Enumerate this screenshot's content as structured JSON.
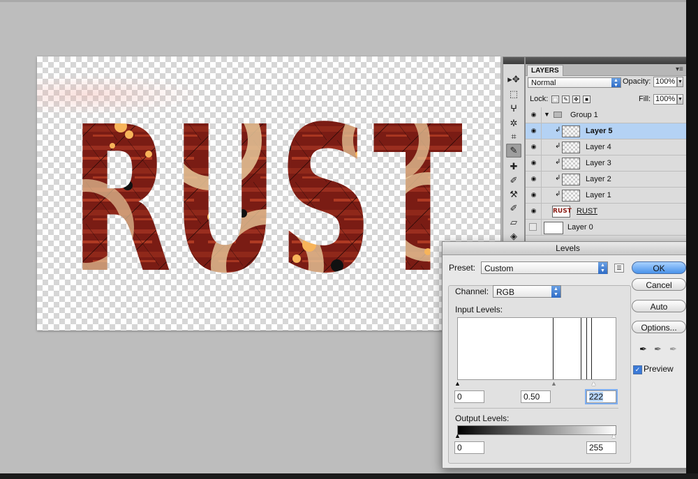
{
  "canvas": {
    "artwork_text": "RUST",
    "colors": {
      "rust_base": "#7a1c14",
      "rust_mid": "#a33222",
      "rust_light": "#c6482a",
      "speckle": "#f7b45a",
      "ring": "#e8c89a",
      "checker": "#d6d6d6"
    }
  },
  "tools": {
    "items": [
      "move-icon",
      "marquee-icon",
      "lasso-icon",
      "magic-wand-icon",
      "crop-icon",
      "eyedropper-icon",
      "healing-brush-icon",
      "brush-icon",
      "clone-stamp-icon",
      "history-brush-icon",
      "eraser-icon",
      "paint-bucket-icon"
    ],
    "glyphs": [
      "▸✥",
      "⬚",
      "ⵖ",
      "✲",
      "⌗",
      "✎",
      "✚",
      "✐",
      "⚒",
      "✐",
      "▱",
      "◈"
    ]
  },
  "layers_panel": {
    "tab_label": "LAYERS",
    "blend_mode": "Normal",
    "opacity_label": "Opacity:",
    "opacity_value": "100%",
    "lock_label": "Lock:",
    "fill_label": "Fill:",
    "fill_value": "100%",
    "layers": [
      {
        "name": "Group 1",
        "type": "group"
      },
      {
        "name": "Layer 5",
        "type": "clipped",
        "selected": true
      },
      {
        "name": "Layer 4",
        "type": "clipped"
      },
      {
        "name": "Layer 3",
        "type": "clipped"
      },
      {
        "name": "Layer 2",
        "type": "clipped"
      },
      {
        "name": "Layer 1",
        "type": "clipped"
      },
      {
        "name": "RUST",
        "type": "text",
        "thumb_text": "RUST"
      },
      {
        "name": "Layer 0",
        "type": "background",
        "visible": false
      }
    ]
  },
  "levels_dialog": {
    "title": "Levels",
    "preset_label": "Preset:",
    "preset_value": "Custom",
    "channel_label": "Channel:",
    "channel_value": "RGB",
    "input_levels_label": "Input Levels:",
    "input_black": "0",
    "input_gamma": "0.50",
    "input_white": "222",
    "output_levels_label": "Output Levels:",
    "output_black": "0",
    "output_white": "255",
    "buttons": {
      "ok": "OK",
      "cancel": "Cancel",
      "auto": "Auto",
      "options": "Options..."
    },
    "preview_label": "Preview",
    "preview_checked": true
  }
}
